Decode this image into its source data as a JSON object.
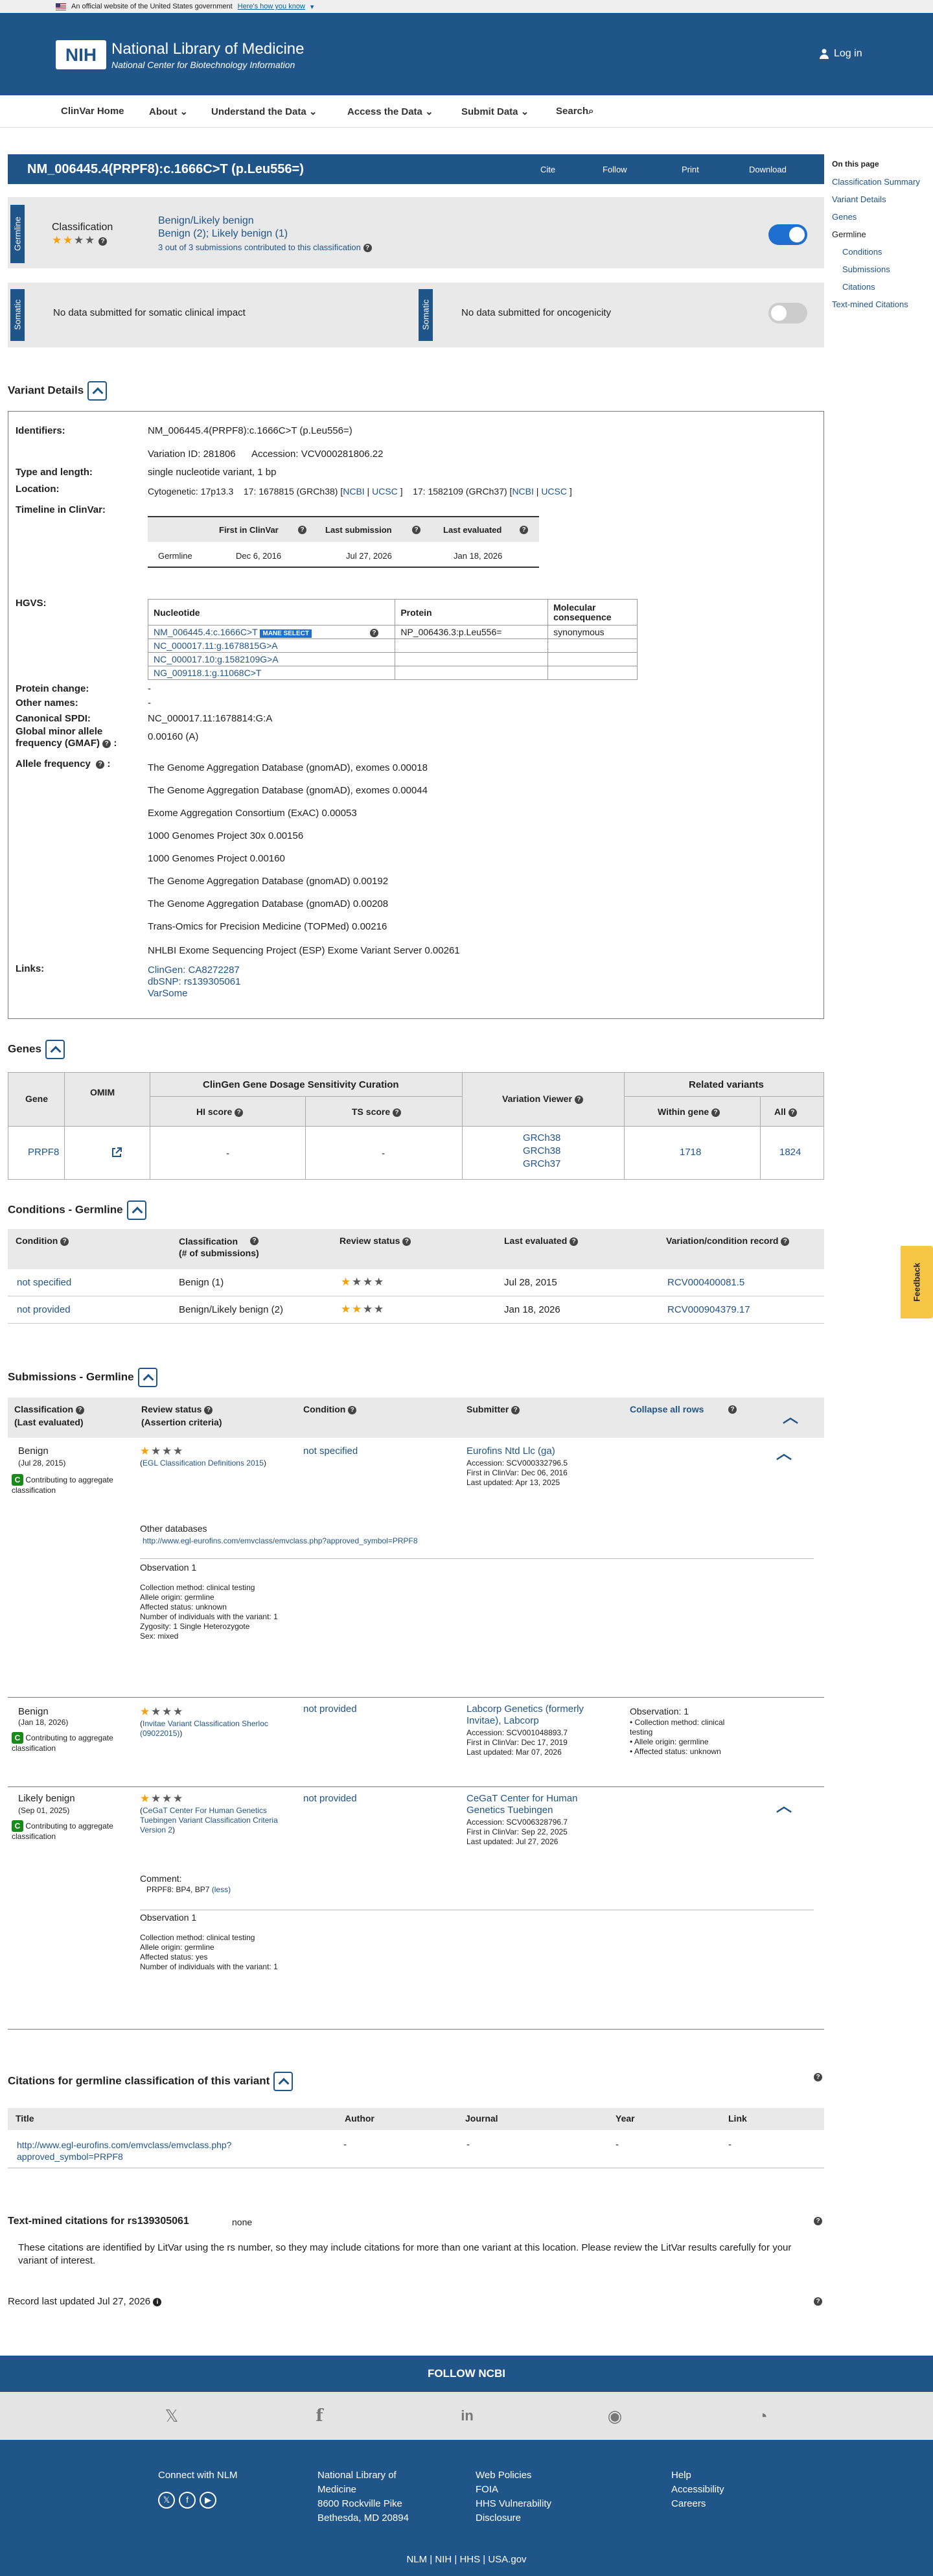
{
  "gov_banner": {
    "text": "An official website of the United States government",
    "link": "Here's how you know"
  },
  "header": {
    "logo": "NIH",
    "title": "National Library of Medicine",
    "subtitle": "National Center for Biotechnology Information",
    "login": "Log in"
  },
  "nav": [
    "ClinVar Home",
    "About",
    "Understand the Data",
    "Access the Data",
    "Submit Data",
    "Search"
  ],
  "variant_bar": {
    "title": "NM_006445.4(PRPF8):c.1666C>T (p.Leu556=)",
    "actions": [
      "Cite",
      "Follow",
      "Print",
      "Download"
    ]
  },
  "sidebar": {
    "heading": "On this page",
    "items": [
      "Classification Summary",
      "Variant Details",
      "Genes",
      "Germline",
      "Conditions",
      "Submissions",
      "Citations",
      "Text-mined Citations"
    ]
  },
  "germline": {
    "tab": "Germline",
    "label": "Classification",
    "classification": "Benign/Likely benign",
    "detail": "Benign (2); Likely benign (1)",
    "note": "3 out of 3 submissions contributed to this classification",
    "stars": 2
  },
  "somatic": {
    "tab": "Somatic",
    "clinical": "No data submitted for somatic clinical impact",
    "onco": "No data submitted for oncogenicity"
  },
  "variant_details": {
    "heading": "Variant Details",
    "identifiers_label": "Identifiers:",
    "identifier": "NM_006445.4(PRPF8):c.1666C>T (p.Leu556=)",
    "variation_id": "Variation ID: 281806",
    "accession": "Accession: VCV000281806.22",
    "type_label": "Type and length:",
    "type": "single nucleotide variant, 1 bp",
    "location_label": "Location:",
    "cyto": "Cytogenetic: 17p13.3",
    "grch38": "17: 1678815 (GRCh38) [",
    "ncbi": "NCBI",
    "ucsc": "UCSC",
    "grch37": "17: 1582109 (GRCh37) [",
    "timeline_label": "Timeline in ClinVar:",
    "timeline_headers": [
      "",
      "First in ClinVar",
      "Last submission",
      "Last evaluated"
    ],
    "timeline_row": [
      "Germline",
      "Dec 6, 2016",
      "Jul 27, 2026",
      "Jan 18, 2026"
    ],
    "hgvs_label": "HGVS:",
    "hgvs_headers": [
      "Nucleotide",
      "Protein",
      "Molecular consequence"
    ],
    "hgvs_rows": [
      [
        "NM_006445.4:c.1666C>T",
        "NP_006436.3:p.Leu556=",
        "synonymous"
      ],
      [
        "NC_000017.11:g.1678815G>A",
        "",
        ""
      ],
      [
        "NC_000017.10:g.1582109G>A",
        "",
        ""
      ],
      [
        "NG_009118.1:g.11068C>T",
        "",
        ""
      ]
    ],
    "mane": "MANE SELECT",
    "protein_change_label": "Protein change:",
    "protein_change": "-",
    "other_names_label": "Other names:",
    "other_names": "-",
    "spdi_label": "Canonical SPDI:",
    "spdi": "NC_000017.11:1678814:G:A",
    "gmaf_label": "Global minor allele frequency (GMAF)",
    "gmaf": "0.00160 (A)",
    "af_label": "Allele frequency",
    "af": [
      "The Genome Aggregation Database (gnomAD), exomes 0.00018",
      "The Genome Aggregation Database (gnomAD), exomes 0.00044",
      "Exome Aggregation Consortium (ExAC) 0.00053",
      "1000 Genomes Project 30x 0.00156",
      "1000 Genomes Project 0.00160",
      "The Genome Aggregation Database (gnomAD) 0.00192",
      "The Genome Aggregation Database (gnomAD) 0.00208",
      "Trans-Omics for Precision Medicine (TOPMed) 0.00216",
      "NHLBI Exome Sequencing Project (ESP) Exome Variant Server 0.00261"
    ],
    "links_label": "Links:",
    "links": [
      "ClinGen: CA8272287",
      "dbSNP: rs139305061",
      "VarSome"
    ]
  },
  "genes": {
    "heading": "Genes",
    "h_gene": "Gene",
    "h_omim": "OMIM",
    "h_clingen": "ClinGen Gene Dosage Sensitivity Curation",
    "h_hi": "HI score",
    "h_ts": "TS score",
    "h_viewer": "Variation Viewer",
    "h_related": "Related variants",
    "h_within": "Within gene",
    "h_all": "All",
    "gene": "PRPF8",
    "hi": "-",
    "ts": "-",
    "viewer": [
      "GRCh38",
      "GRCh38",
      "GRCh37"
    ],
    "within": "1718",
    "all": "1824"
  },
  "conditions": {
    "heading": "Conditions - Germline",
    "headers": [
      "Condition",
      "Classification\n(# of submissions)",
      "Review status",
      "Last evaluated",
      "Variation/condition record"
    ],
    "rows": [
      [
        "not specified",
        "Benign (1)",
        "Jul 28, 2015",
        "RCV000400081.5"
      ],
      [
        "not provided",
        "Benign/Likely benign (2)",
        "Jan 18, 2026",
        "RCV000904379.17"
      ]
    ]
  },
  "submissions": {
    "heading": "Submissions - Germline",
    "h_class": "Classification",
    "h_class2": "(Last evaluated)",
    "h_review": "Review status",
    "h_review2": "(Assertion criteria)",
    "h_cond": "Condition",
    "h_sub": "Submitter",
    "collapse": "Collapse all rows",
    "contrib": "Contributing to aggregate classification",
    "s1": {
      "cls": "Benign",
      "date": "(Jul 28, 2015)",
      "criteria": "EGL Classification Definitions 2015",
      "cond": "not specified",
      "submitter": "Eurofins Ntd Llc (ga)",
      "acc": "Accession: SCV000332796.5",
      "first": "First in ClinVar: Dec 06, 2016",
      "upd": "Last updated: Apr 13, 2025",
      "other_db": "Other databases",
      "other_url": "http://www.egl-eurofins.com/emvclass/emvclass.php?approved_symbol=PRPF8",
      "obs": "Observation 1",
      "obs_lines": [
        "Collection method: clinical testing",
        "Allele origin: germline",
        "Affected status: unknown",
        "Number of individuals with the variant: 1",
        "Zygosity: 1 Single Heterozygote",
        "Sex: mixed"
      ]
    },
    "s2": {
      "cls": "Benign",
      "date": "(Jan 18, 2026)",
      "criteria": "Invitae Variant Classification Sherloc (09022015)",
      "cond": "not provided",
      "submitter": "Labcorp Genetics (formerly Invitae), Labcorp",
      "acc": "Accession: SCV001048893.7",
      "first": "First in ClinVar: Dec 17, 2019",
      "upd": "Last updated: Mar 07, 2026",
      "obs": "Observation: 1",
      "obs_lines": [
        "Collection method: clinical testing",
        "Allele origin: germline",
        "Affected status: unknown"
      ]
    },
    "s3": {
      "cls": "Likely benign",
      "date": "(Sep 01, 2025)",
      "criteria": "CeGaT Center For Human Genetics Tuebingen Variant Classification Criteria Version 2",
      "cond": "not provided",
      "submitter": "CeGaT Center for Human Genetics Tuebingen",
      "acc": "Accession: SCV006328796.7",
      "first": "First in ClinVar: Sep 22, 2025",
      "upd": "Last updated: Jul 27, 2026",
      "comment_label": "Comment:",
      "comment": "PRPF8: BP4, BP7",
      "less": "(less)",
      "obs": "Observation 1",
      "obs_lines": [
        "Collection method: clinical testing",
        "Allele origin: germline",
        "Affected status: yes",
        "Number of individuals with the variant: 1"
      ]
    }
  },
  "citations": {
    "heading": "Citations for germline classification of this variant",
    "headers": [
      "Title",
      "Author",
      "Journal",
      "Year",
      "Link"
    ],
    "row": [
      "http://www.egl-eurofins.com/emvclass/emvclass.php?approved_symbol=PRPF8",
      "-",
      "-",
      "-",
      "-"
    ]
  },
  "textmined": {
    "heading": "Text-mined citations for rs139305061",
    "none": "none",
    "text": "These citations are identified by LitVar using the rs number, so they may include citations for more than one variant at this location. Please review the LitVar results carefully for your variant of interest."
  },
  "record": "Record last updated Jul 27, 2026",
  "feedback": "Feedback",
  "footer": {
    "follow": "FOLLOW NCBI",
    "connect": "Connect with NLM",
    "nlm": [
      "National Library of",
      "Medicine",
      "8600 Rockville Pike",
      "Bethesda, MD 20894"
    ],
    "col3": [
      "Web Policies",
      "FOIA",
      "HHS Vulnerability",
      "Disclosure"
    ],
    "col4": [
      "Help",
      "Accessibility",
      "Careers"
    ],
    "bottom": [
      "NLM",
      "NIH",
      "HHS",
      "USA.gov"
    ]
  }
}
